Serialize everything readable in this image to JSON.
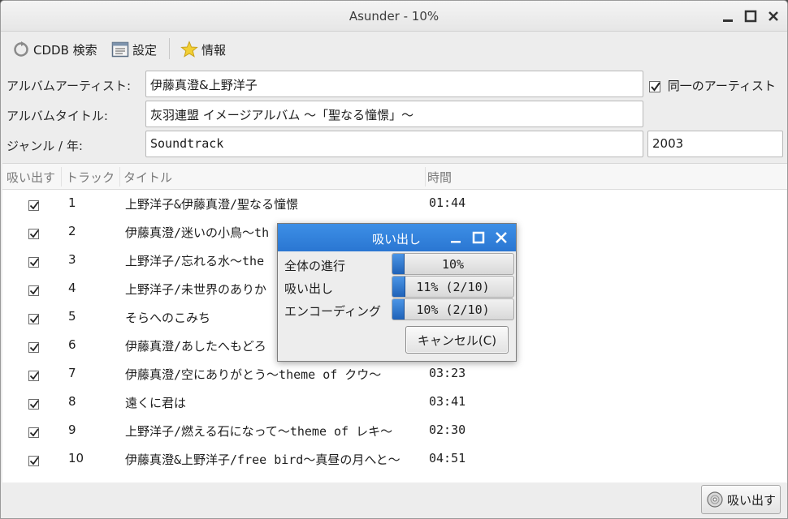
{
  "window": {
    "title": "Asunder - 10%"
  },
  "toolbar": {
    "cddb_label": "CDDB 検索",
    "prefs_label": "設定",
    "about_label": "情報"
  },
  "form": {
    "album_artist_label": "アルバムアーティスト:",
    "album_artist_value": "伊藤真澄&上野洋子",
    "single_artist_label": "同一のアーティスト",
    "single_artist_checked": true,
    "album_title_label": "アルバムタイトル:",
    "album_title_value": "灰羽連盟 イメージアルバム ～「聖なる憧憬」～",
    "genre_year_label": "ジャンル / 年:",
    "genre_value": "Soundtrack",
    "year_value": "2003"
  },
  "table": {
    "headers": {
      "rip": "吸い出す",
      "track": "トラック",
      "title": "タイトル",
      "time": "時間"
    },
    "rows": [
      {
        "track": "1",
        "title": "上野洋子&伊藤真澄/聖なる憧憬",
        "time": "01:44"
      },
      {
        "track": "2",
        "title": "伊藤真澄/迷いの小鳥～th",
        "time": ""
      },
      {
        "track": "3",
        "title": "上野洋子/忘れる水～the",
        "time": ""
      },
      {
        "track": "4",
        "title": "上野洋子/未世界のありか",
        "time": ""
      },
      {
        "track": "5",
        "title": "そらへのこみち",
        "time": ""
      },
      {
        "track": "6",
        "title": "伊藤真澄/あしたへもどろ",
        "time": ""
      },
      {
        "track": "7",
        "title": "伊藤真澄/空にありがとう～theme of クウ～",
        "time": "03:23"
      },
      {
        "track": "8",
        "title": "遠くに君は",
        "time": "03:41"
      },
      {
        "track": "9",
        "title": "上野洋子/燃える石になって～theme of レキ～",
        "time": "02:30"
      },
      {
        "track": "10",
        "title": "伊藤真澄&上野洋子/free bird～真昼の月へと～",
        "time": "04:51"
      }
    ]
  },
  "bottom": {
    "rip_label": "吸い出す"
  },
  "dialog": {
    "title": "吸い出し",
    "total_label": "全体の進行",
    "total_text": "10%",
    "total_fraction": 0.1,
    "rip_label": "吸い出し",
    "rip_text": "11% (2/10)",
    "rip_fraction": 0.11,
    "encode_label": "エンコーディング",
    "encode_text": "10% (2/10)",
    "encode_fraction": 0.1,
    "cancel_label": "キャンセル(C)"
  },
  "colors": {
    "accent": "#2a76d2",
    "titlebar": "#ececec"
  }
}
